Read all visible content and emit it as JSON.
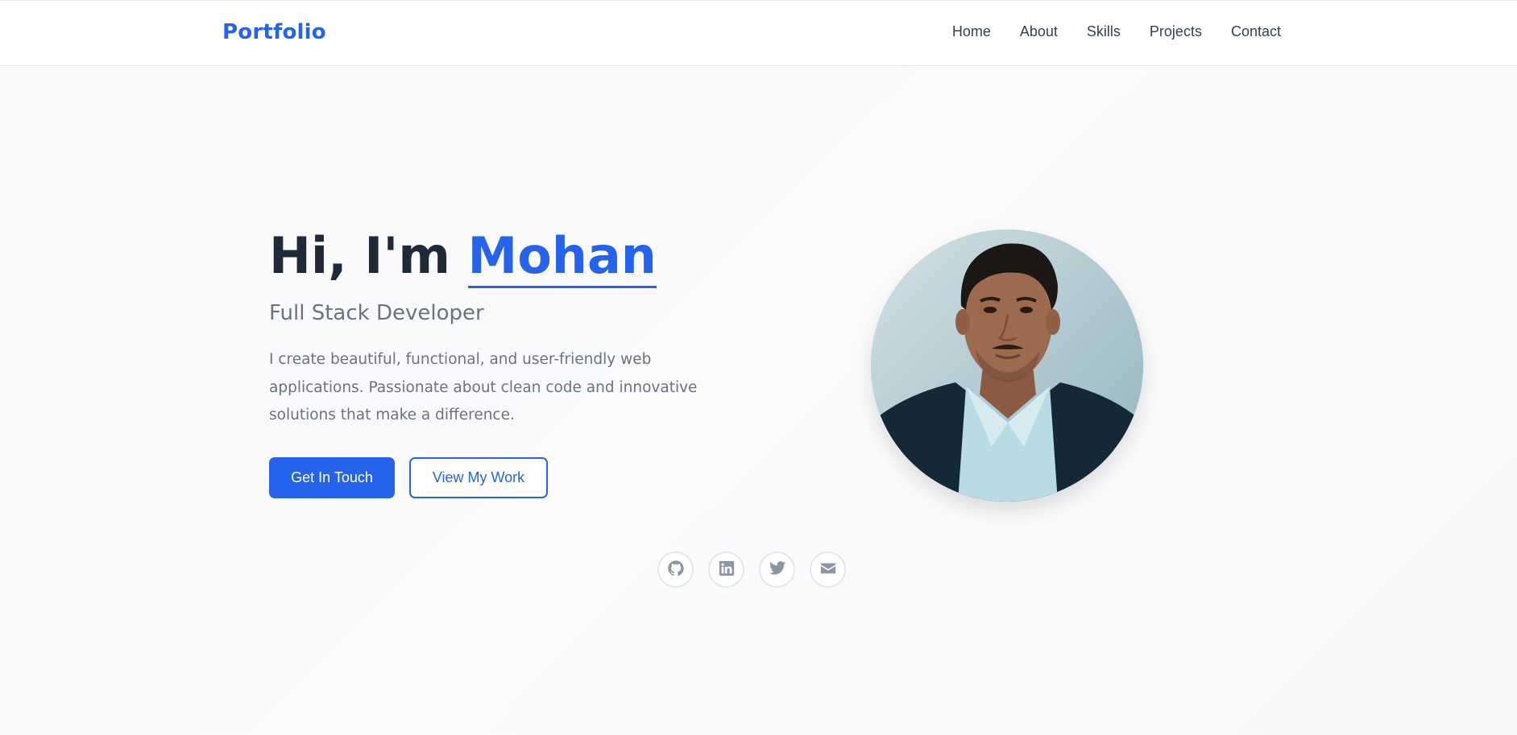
{
  "nav": {
    "brand": "Portfolio",
    "links": [
      "Home",
      "About",
      "Skills",
      "Projects",
      "Contact"
    ]
  },
  "hero": {
    "greeting": "Hi, I'm ",
    "name": "Mohan",
    "subtitle": "Full Stack Developer",
    "description": "I create beautiful, functional, and user-friendly web applications. Passionate about clean code and innovative solutions that make a difference.",
    "primary_button": "Get In Touch",
    "secondary_button": "View My Work"
  },
  "social": [
    "github-icon",
    "linkedin-icon",
    "twitter-icon",
    "envelope-icon"
  ],
  "colors": {
    "accent": "#2563eb",
    "heading": "#1f2937",
    "muted": "#6b7280",
    "icon": "#8b95a3"
  }
}
